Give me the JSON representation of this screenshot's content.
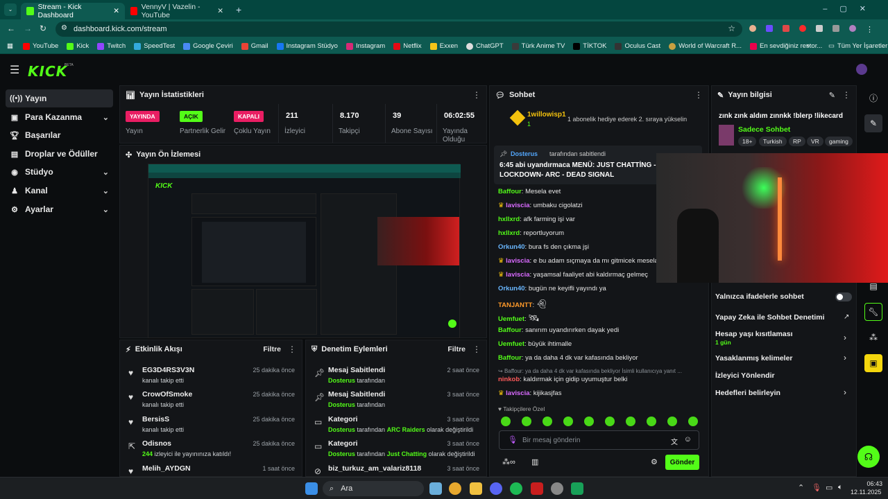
{
  "browser": {
    "tabs": [
      {
        "label": "Stream - Kick Dashboard"
      },
      {
        "label": "VennyV | Vazelin - YouTube"
      }
    ],
    "url": "dashboard.kick.com/stream",
    "bookmarks": [
      "YouTube",
      "Kick",
      "Twitch",
      "SpeedTest",
      "Google Çeviri",
      "Gmail",
      "Instagram Stüdyo",
      "Instagram",
      "Netflix",
      "Exxen",
      "ChatGPT",
      "Türk Anime TV",
      "TİKTOK",
      "Oculus Cast",
      "World of Warcraft R...",
      "En sevdiğiniz restor..."
    ],
    "all_bookmarks": "Tüm Yer İşaretleri"
  },
  "kick": {
    "logo": "KICK",
    "beta": "BETA"
  },
  "sidebar": {
    "items": [
      {
        "label": "Yayın"
      },
      {
        "label": "Para Kazanma"
      },
      {
        "label": "Başarılar"
      },
      {
        "label": "Droplar ve Ödüller"
      },
      {
        "label": "Stüdyo"
      },
      {
        "label": "Kanal"
      },
      {
        "label": "Ayarlar"
      }
    ]
  },
  "stats": {
    "title": "Yayın İstatistikleri",
    "badges": [
      {
        "badge": "YAYINDA",
        "label": "Yayın"
      },
      {
        "badge": "AÇIK",
        "label": "Partnerlik Gelir"
      },
      {
        "badge": "KAPALI",
        "label": "Çoklu Yayın"
      }
    ],
    "values": [
      {
        "value": "211",
        "label": "İzleyici"
      },
      {
        "value": "8.170",
        "label": "Takipçi"
      },
      {
        "value": "39",
        "label": "Abone Sayısı"
      },
      {
        "value": "06:02:55",
        "label": "Yayında Olduğu"
      }
    ]
  },
  "preview": {
    "title": "Yayın Ön İzlemesi"
  },
  "activity": {
    "title": "Etkinlik Akışı",
    "filter": "Filtre",
    "items": [
      {
        "name": "EG3D4RS3V3N",
        "text": "kanalı takip etti",
        "time": "25 dakika önce"
      },
      {
        "name": "CrowOfSmoke",
        "text": "kanalı takip etti",
        "time": "25 dakika önce"
      },
      {
        "name": "BersisS",
        "text": "kanalı takip etti",
        "time": "25 dakika önce"
      },
      {
        "name": "Odisnos",
        "count": "244",
        "text": "izleyici ile yayınınıza katıldı!",
        "time": "25 dakika önce"
      },
      {
        "name": "Melih_AYDGN",
        "text": "",
        "time": "1 saat önce"
      }
    ]
  },
  "moderation": {
    "title": "Denetim Eylemleri",
    "filter": "Filtre",
    "items": [
      {
        "title": "Mesaj Sabitlendi",
        "by": "Dosterus",
        "rest": "tarafından",
        "time": "2 saat önce"
      },
      {
        "title": "Mesaj Sabitlendi",
        "by": "Dosterus",
        "rest": "tarafından",
        "time": "3 saat önce"
      },
      {
        "title": "Kategori",
        "by": "Dosterus",
        "rest": "tarafından",
        "cat": "ARC Raiders",
        "rest2": "olarak değiştirildi",
        "time": "3 saat önce"
      },
      {
        "title": "Kategori",
        "by": "Dosterus",
        "rest": "tarafından",
        "cat": "Just Chatting",
        "rest2": "olarak değiştirildi",
        "time": "3 saat önce"
      },
      {
        "title": "biz_turkuz_am_valariz8118",
        "time": "3 saat önce"
      }
    ]
  },
  "chat": {
    "title": "Sohbet",
    "gift": {
      "user": "1willowisp1",
      "count": "1",
      "text": "1 abonelik hediye ederek 2. sıraya yükselin"
    },
    "pinned": {
      "by": "Dosterus",
      "by_rest": "tarafından sabitlendi",
      "text": "6:45 abi uyandırmaca MENÜ: JUST CHATTİNG - LOCKDOWN- ARC - DEAD SIGNAL"
    },
    "messages": [
      {
        "user": "Baffour",
        "text": "Mesela evet"
      },
      {
        "user": "laviscia",
        "text": "umbaku cigolatzi"
      },
      {
        "user": "hxllxrd",
        "text": "afk farming işi var"
      },
      {
        "user": "hxllxrd",
        "text": "reportluyorum"
      },
      {
        "user": "Orkun40",
        "text": "bura fs den çıkma jşi"
      },
      {
        "user": "laviscia",
        "text": "e bu adam sıçmaya da mı gitmicek mesela"
      },
      {
        "user": "laviscia",
        "text": "yaşamsal faaliyet abi kaldırmaç gelmeç"
      },
      {
        "user": "Orkun40",
        "text": "bugün ne keyifli yayındı ya"
      },
      {
        "user": "TANJANTT",
        "text": ""
      },
      {
        "user": "Uemfuet",
        "text": ""
      },
      {
        "user": "Baffour",
        "text": "sanırım uyandırırken dayak yedi"
      },
      {
        "user": "Uemfuet",
        "text": "büyük ihtimalle"
      },
      {
        "user": "Baffour",
        "text": "ya da daha 4 dk var kafasında bekliyor"
      },
      {
        "user": "ninkob",
        "text": "kaldırmak için gidip uyumuştur belki",
        "reply": "Baffour: ya da daha 4 dk var kafasında bekliyor İsimli kullanıcıya yanıt ..."
      },
      {
        "user": "laviscia",
        "text": "kijikasjfas"
      }
    ],
    "emote_section": "Takipçilere Özel",
    "input_placeholder": "Bir mesaj gönderin",
    "send": "Gönder"
  },
  "info": {
    "title": "Yayın bilgisi",
    "stream_title": "zınk zınk aldım zınnkk !blerp !likecard",
    "category": "Sadece Sohbet",
    "tags": [
      "18+",
      "Turkish",
      "RP",
      "VR",
      "gaming"
    ]
  },
  "settings": {
    "emote_only": "Yalnızca ifadelerle sohbet",
    "ai": "Yapay Zeka ile Sohbet Denetimi",
    "account_age": "Hesap yaşı kısıtlaması",
    "account_age_val": "1 gün",
    "banned_words": "Yasaklanmış kelimeler",
    "redirect": "İzleyici Yönlendir",
    "goals": "Hedefleri belirleyin"
  },
  "taskbar": {
    "search": "Ara",
    "time": "06:43",
    "date": "12.11.2025"
  },
  "colors": {
    "accent": "#53fc18",
    "live": "#e91e63",
    "browser": "#0e5a51"
  }
}
